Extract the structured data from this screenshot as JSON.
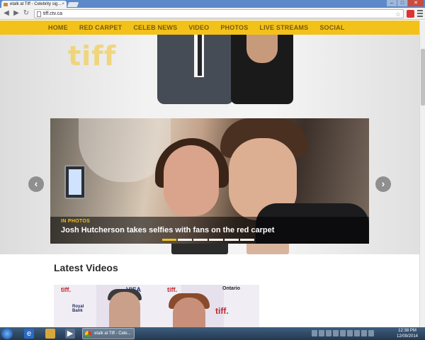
{
  "browser": {
    "tab_title": "etalk at Tiff - Celebrity sig…",
    "tab_close": "×",
    "url": "tiff.ctv.ca",
    "back_icon": "arrow-left",
    "forward_icon": "arrow-right",
    "reload_icon": "reload",
    "star_icon": "☆",
    "window_controls": [
      "–",
      "□",
      "✕"
    ]
  },
  "site": {
    "nav": [
      "HOME",
      "RED CARPET",
      "CELEB NEWS",
      "VIDEO",
      "PHOTOS",
      "LIVE STREAMS",
      "SOCIAL"
    ],
    "logo": "tiff",
    "accent_color": "#f3c21a",
    "slider": {
      "kicker": "IN PHOTOS",
      "title": "Josh Hutcherson takes selfies with fans on the red carpet",
      "prev_label": "‹",
      "next_label": "›",
      "slide_count": 6,
      "active_slide": 0
    },
    "latest_videos": {
      "title": "Latest Videos",
      "sponsors": [
        "tiff.",
        "VISA",
        "tiff.",
        "Ontario",
        "Royal Bank",
        "tiff."
      ]
    }
  },
  "taskbar": {
    "task_label": "etalk at Tiff - Cele...",
    "time": "12:38 PM",
    "date": "12/09/2014"
  }
}
